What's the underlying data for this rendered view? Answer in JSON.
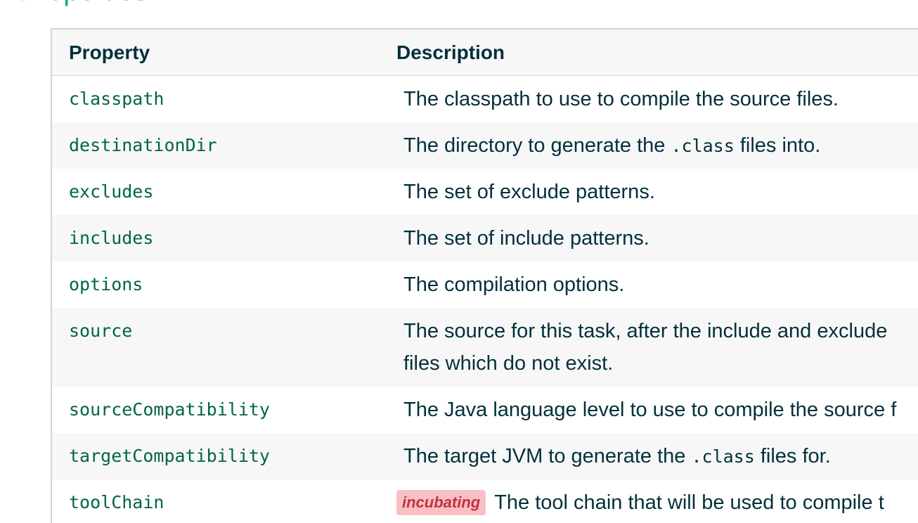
{
  "section": {
    "title": "Properties"
  },
  "table": {
    "headers": {
      "property": "Property",
      "description": "Description"
    },
    "rows": [
      {
        "property": "classpath",
        "description": "The classpath to use to compile the source files."
      },
      {
        "property": "destinationDir",
        "description_before": "The directory to generate the ",
        "description_code": ".class",
        "description_after": " files into."
      },
      {
        "property": "excludes",
        "description": "The set of exclude patterns."
      },
      {
        "property": "includes",
        "description": "The set of include patterns."
      },
      {
        "property": "options",
        "description": "The compilation options."
      },
      {
        "property": "source",
        "description_line1": "The source for this task, after the include and exclude",
        "description_line2": "files which do not exist."
      },
      {
        "property": "sourceCompatibility",
        "description": "The Java language level to use to compile the source f"
      },
      {
        "property": "targetCompatibility",
        "description_before": "The target JVM to generate the ",
        "description_code": ".class",
        "description_after": " files for."
      },
      {
        "property": "toolChain",
        "badge": "incubating",
        "description": "The tool chain that will be used to compile t"
      }
    ]
  },
  "colors": {
    "title": "#1ba56b",
    "property_link": "#006546",
    "text": "#02303a",
    "row_alt": "#f7f7f8",
    "border": "#d5d5d5",
    "badge_bg": "#f9c0c4",
    "badge_text": "#c33240"
  }
}
